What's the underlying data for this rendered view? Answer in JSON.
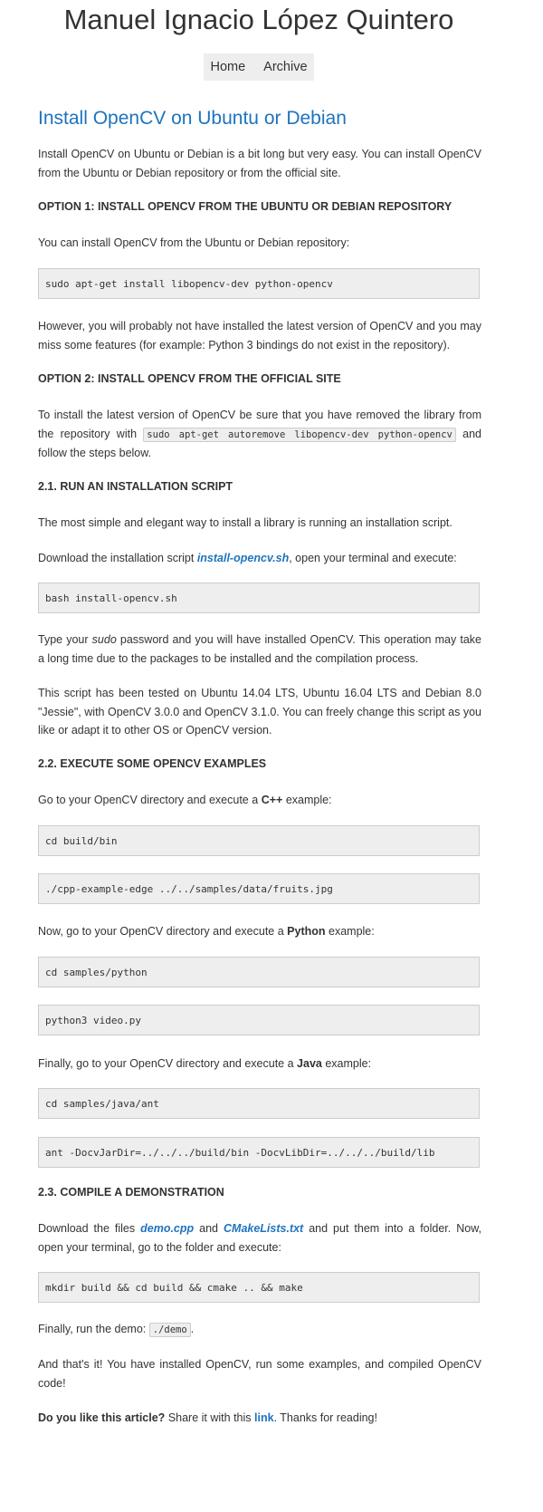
{
  "site": {
    "title": "Manuel Ignacio López Quintero"
  },
  "nav": {
    "home": "Home",
    "archive": "Archive"
  },
  "article": {
    "title": "Install OpenCV on Ubuntu or Debian",
    "intro": "Install OpenCV on Ubuntu or Debian is a bit long but very easy. You can install OpenCV from the Ubuntu or Debian repository or from the official site.",
    "opt1_heading": "OPTION 1: INSTALL OPENCV FROM THE UBUNTU OR DEBIAN REPOSITORY",
    "opt1_text": "You can install OpenCV from the Ubuntu or Debian repository:",
    "opt1_code": "sudo apt-get install libopencv-dev python-opencv",
    "opt1_note": "However, you will probably not have installed the latest version of OpenCV and you may miss some features (for example: Python 3 bindings do not exist in the repository).",
    "opt2_heading": "OPTION 2: INSTALL OPENCV FROM THE OFFICIAL SITE",
    "opt2_text_a": "To install the latest version of OpenCV be sure that you have removed the library from the repository with",
    "opt2_inline_code": "sudo apt-get autoremove libopencv-dev python-opencv",
    "opt2_text_b": "and follow the steps below.",
    "s21_heading": "2.1. RUN AN INSTALLATION SCRIPT",
    "s21_text": "The most simple and elegant way to install a library is running an installation script.",
    "s21_download_a": "Download the installation script",
    "s21_download_link": "install-opencv.sh",
    "s21_download_b": ", open your terminal and execute:",
    "s21_code": "bash install-opencv.sh",
    "s21_type_a": "Type your",
    "s21_type_em": "sudo",
    "s21_type_b": "password and you will have installed OpenCV. This operation may take a long time due to the packages to be installed and the compilation process.",
    "s21_tested": "This script has been tested on Ubuntu 14.04 LTS, Ubuntu 16.04 LTS and Debian 8.0 \"Jessie\", with OpenCV 3.0.0 and OpenCV 3.1.0. You can freely change this script as you like or adapt it to other OS or OpenCV version.",
    "s22_heading": "2.2. EXECUTE SOME OPENCV EXAMPLES",
    "s22_cpp_a": "Go to your OpenCV directory and execute a",
    "s22_cpp_b": "C++",
    "s22_cpp_c": "example:",
    "s22_cpp_code1": "cd build/bin",
    "s22_cpp_code2": "./cpp-example-edge ../../samples/data/fruits.jpg",
    "s22_py_a": "Now, go to your OpenCV directory and execute a",
    "s22_py_b": "Python",
    "s22_py_c": "example:",
    "s22_py_code1": "cd samples/python",
    "s22_py_code2": "python3 video.py",
    "s22_java_a": "Finally, go to your OpenCV directory and execute a",
    "s22_java_b": "Java",
    "s22_java_c": "example:",
    "s22_java_code1": "cd samples/java/ant",
    "s22_java_code2": "ant -DocvJarDir=../../../build/bin -DocvLibDir=../../../build/lib",
    "s23_heading": "2.3. COMPILE A DEMONSTRATION",
    "s23_text_a": "Download the files",
    "s23_link1": "demo.cpp",
    "s23_text_and": "and",
    "s23_link2": "CMakeLists.txt",
    "s23_text_b": "and put them into a folder. Now, open your terminal, go to the folder and execute:",
    "s23_code": "mkdir build && cd build && cmake .. && make",
    "s23_run_a": "Finally, run the demo:",
    "s23_run_code": "./demo",
    "s23_run_b": ".",
    "outro": "And that's it! You have installed OpenCV, run some examples, and compiled OpenCV code!",
    "share_bold": "Do you like this article?",
    "share_a": "Share it with this",
    "share_link": "link",
    "share_b": ". Thanks for reading!"
  },
  "colors": {
    "link": "#1e73be",
    "code_bg": "#eeeeee",
    "text": "#333333"
  }
}
